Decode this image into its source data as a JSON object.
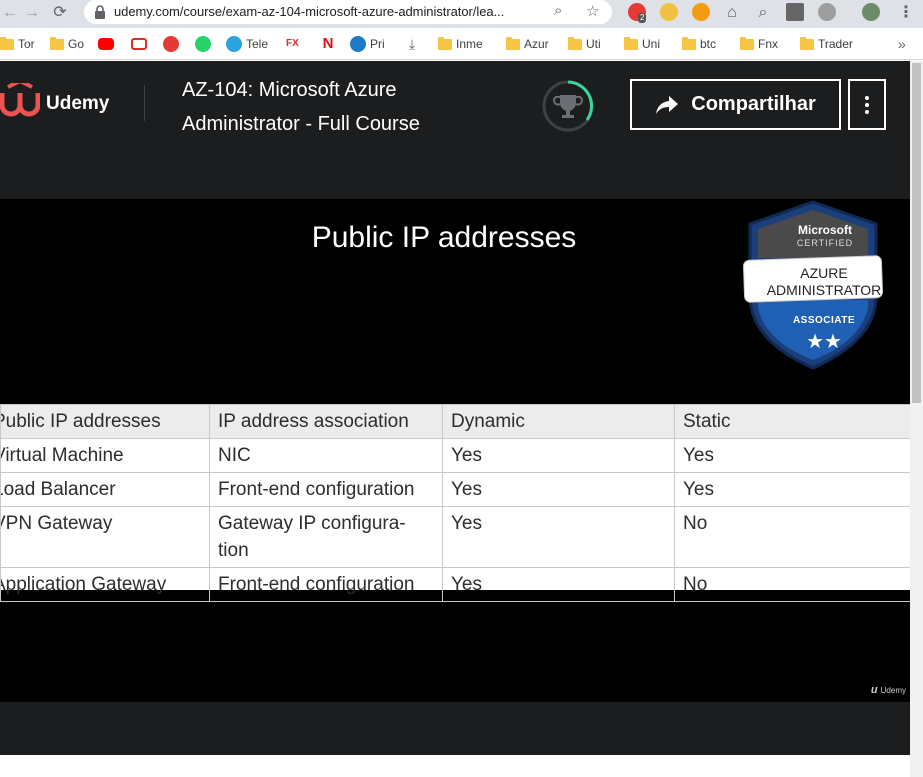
{
  "browser": {
    "url": "udemy.com/course/exam-az-104-microsoft-azure-administrator/lea...",
    "extension_badge": "2",
    "bookmarks": [
      {
        "label": "Tor",
        "icon": "folder-icon"
      },
      {
        "label": "Go",
        "icon": "folder-icon"
      },
      {
        "label": "",
        "icon": "youtube-icon"
      },
      {
        "label": "",
        "icon": "gmail-icon"
      },
      {
        "label": "",
        "icon": "podcast-icon"
      },
      {
        "label": "",
        "icon": "whatsapp-icon"
      },
      {
        "label": "Tele",
        "icon": "telegram-icon"
      },
      {
        "label": "",
        "icon": "simplefx-icon"
      },
      {
        "label": "",
        "icon": "netflix-icon"
      },
      {
        "label": "Pri",
        "icon": "primevideo-icon"
      },
      {
        "label": "",
        "icon": "download-icon"
      },
      {
        "label": "Inme",
        "icon": "folder-icon"
      },
      {
        "label": "Azur",
        "icon": "folder-icon"
      },
      {
        "label": "Uti",
        "icon": "folder-icon"
      },
      {
        "label": "Uni",
        "icon": "folder-icon"
      },
      {
        "label": "btc",
        "icon": "folder-icon"
      },
      {
        "label": "Fnx",
        "icon": "folder-icon"
      },
      {
        "label": "Trader",
        "icon": "folder-icon"
      }
    ],
    "overflow_label": "»"
  },
  "header": {
    "logo_text": "Udemy",
    "course_title": "AZ-104: Microsoft Azure Administrator - Full Course",
    "share_label": "Compartilhar"
  },
  "slide": {
    "title": "Public IP addresses",
    "badge": {
      "brand": "Microsoft",
      "certified": "CERTIFIED",
      "line1": "AZURE",
      "line2": "ADMINISTRATOR",
      "level": "ASSOCIATE"
    },
    "table": {
      "headers": [
        "Public IP addresses",
        "IP address association",
        "Dynamic",
        "Static"
      ],
      "rows": [
        [
          "Virtual Machine",
          "NIC",
          "Yes",
          "Yes"
        ],
        [
          "Load Balancer",
          "Front-end configuration",
          "Yes",
          "Yes"
        ],
        [
          "VPN Gateway",
          "Gateway IP configura-tion",
          "Yes",
          "No"
        ],
        [
          "Application Gateway",
          "Front-end configuration",
          "Yes",
          "No"
        ]
      ]
    },
    "watermark": "Udemy"
  },
  "colors": {
    "udemy_dark": "#1c1d1f",
    "udemy_red": "#ec5252",
    "progress_green": "#3bd49a",
    "badge_blue": "#1f5fb4"
  }
}
